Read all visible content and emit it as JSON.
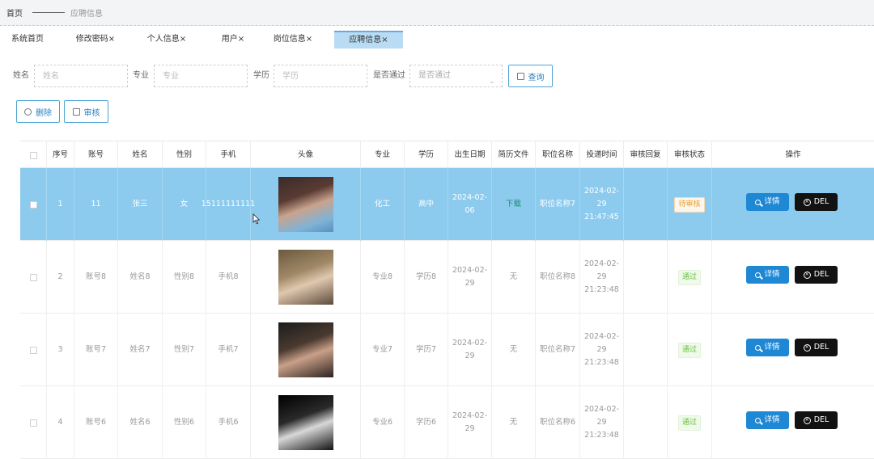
{
  "breadcrumb": {
    "home": "首页",
    "current": "应聘信息"
  },
  "tabs": [
    "系统首页",
    "修改密码×",
    "个人信息×",
    "用户×",
    "岗位信息×",
    "应聘信息×"
  ],
  "search": {
    "name_label": "姓名",
    "name_placeholder": "姓名",
    "major_label": "专业",
    "major_placeholder": "专业",
    "edu_label": "学历",
    "edu_placeholder": "学历",
    "pass_label": "是否通过",
    "pass_placeholder": "是否通过",
    "query_button": "查询"
  },
  "actions": {
    "delete": "删除",
    "audit": "审核"
  },
  "table": {
    "headers": [
      "序号",
      "账号",
      "姓名",
      "性别",
      "手机",
      "头像",
      "专业",
      "学历",
      "出生日期",
      "简历文件",
      "职位名称",
      "投递时间",
      "审核回复",
      "审核状态",
      "操作"
    ],
    "rows": [
      {
        "index": "1",
        "account": "11",
        "name": "张三",
        "gender": "女",
        "phone": "15111111111",
        "avatar": "avatar-woman-1",
        "major": "化工",
        "edu": "高中",
        "birth": "2024-02-06",
        "resume": "下载",
        "position": "职位名称7",
        "time": "2024-02-29 21:47:45",
        "reply": "",
        "status": "待审核",
        "status_type": "pending",
        "selected": true
      },
      {
        "index": "2",
        "account": "账号8",
        "name": "姓名8",
        "gender": "性别8",
        "phone": "手机8",
        "avatar": "avatar-woman-2",
        "major": "专业8",
        "edu": "学历8",
        "birth": "2024-02-29",
        "resume": "无",
        "position": "职位名称8",
        "time": "2024-02-29 21:23:48",
        "reply": "",
        "status": "通过",
        "status_type": "pass",
        "selected": false
      },
      {
        "index": "3",
        "account": "账号7",
        "name": "姓名7",
        "gender": "性别7",
        "phone": "手机7",
        "avatar": "avatar-man-1",
        "major": "专业7",
        "edu": "学历7",
        "birth": "2024-02-29",
        "resume": "无",
        "position": "职位名称7",
        "time": "2024-02-29 21:23:48",
        "reply": "",
        "status": "通过",
        "status_type": "pass",
        "selected": false
      },
      {
        "index": "4",
        "account": "账号6",
        "name": "姓名6",
        "gender": "性别6",
        "phone": "手机6",
        "avatar": "avatar-man-2",
        "major": "专业6",
        "edu": "学历6",
        "birth": "2024-02-29",
        "resume": "无",
        "position": "职位名称6",
        "time": "2024-02-29 21:23:48",
        "reply": "",
        "status": "通过",
        "status_type": "pass",
        "selected": false
      }
    ]
  },
  "row_buttons": {
    "detail": "详情",
    "del": "DEL"
  },
  "colors": {
    "selected_row": "#8ccbee",
    "detail_button": "#1e88d5",
    "del_button": "#121212",
    "accent": "#4aa3d6"
  }
}
